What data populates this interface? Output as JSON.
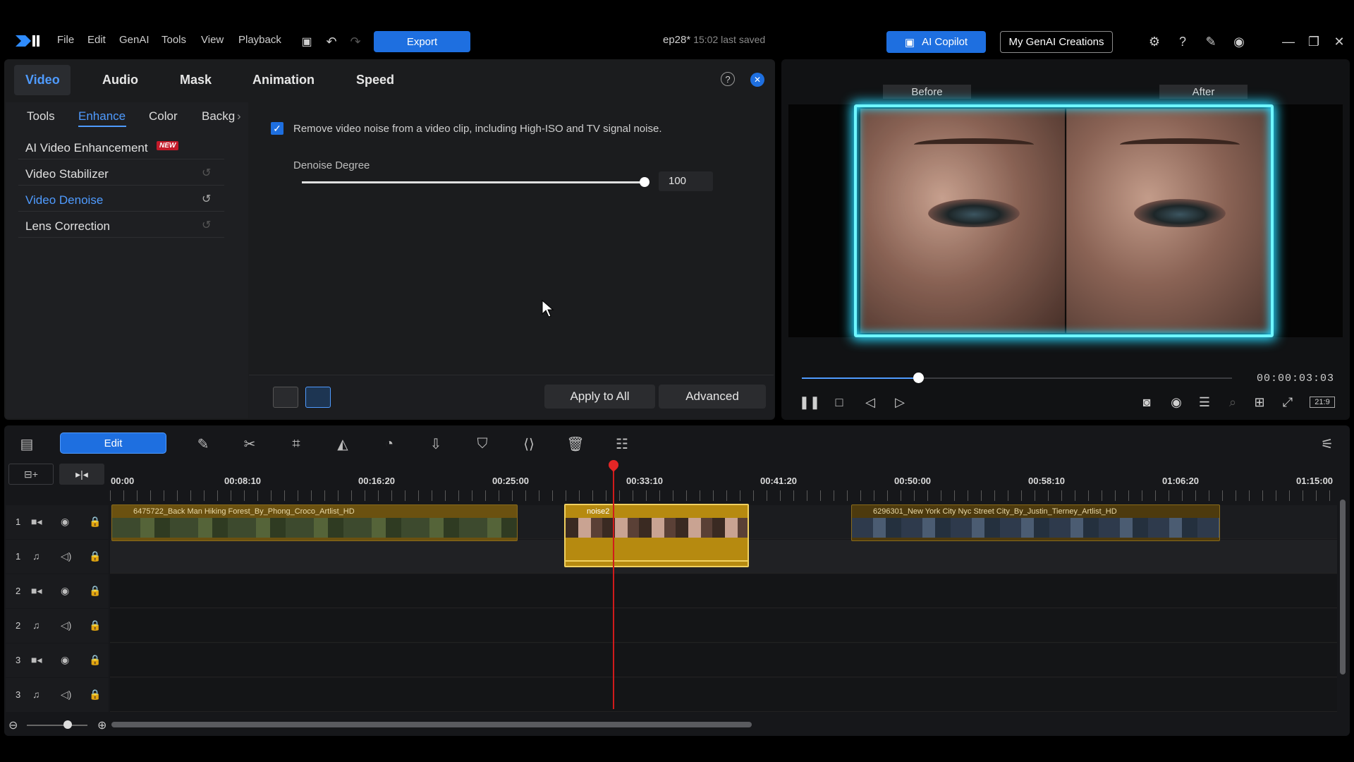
{
  "menu": {
    "items": [
      "File",
      "Edit",
      "GenAI",
      "Tools",
      "View",
      "Playback"
    ]
  },
  "titlebar": {
    "export_label": "Export",
    "project_name": "ep28*",
    "saved_text": "15:02 last saved",
    "copilot_label": "AI Copilot",
    "genai_label": "My GenAI Creations"
  },
  "panel": {
    "tabs": [
      "Video",
      "Audio",
      "Mask",
      "Animation",
      "Speed"
    ],
    "subtabs": [
      "Tools",
      "Enhance",
      "Color",
      "Backg"
    ],
    "items": [
      "AI Video Enhancement",
      "Video Stabilizer",
      "Video Denoise",
      "Lens Correction"
    ],
    "new_badge": "NEW",
    "checkbox_text": "Remove video noise from a video clip, including High-ISO and TV signal noise.",
    "denoise_label": "Denoise Degree",
    "denoise_value": "100",
    "apply_all_label": "Apply to All",
    "advanced_label": "Advanced"
  },
  "preview": {
    "before_label": "Before",
    "after_label": "After",
    "timecode": "00:00:03:03",
    "progress_fraction": 0.27,
    "aspect_label": "21:9"
  },
  "timeline": {
    "edit_label": "Edit",
    "ruler": [
      "00:00",
      "00:08:10",
      "00:16:20",
      "00:25:00",
      "00:33:10",
      "00:41:20",
      "00:50:00",
      "00:58:10",
      "01:06:20",
      "01:15:00"
    ],
    "track_numbers": [
      "1",
      "1",
      "2",
      "2",
      "3",
      "3"
    ],
    "clips": [
      "6475722_Back Man Hiking Forest_By_Phong_Croco_Artlist_HD",
      "noise2",
      "6296301_New York City Nyc Street City_By_Justin_Tierney_Artlist_HD"
    ]
  },
  "colors": {
    "accent": "#1e6fe0",
    "active_text": "#4f9bff",
    "glow": "#6ff6ff",
    "playhead": "#d11b1b",
    "clip": "#6b5110",
    "selected_clip": "#b68a10"
  }
}
